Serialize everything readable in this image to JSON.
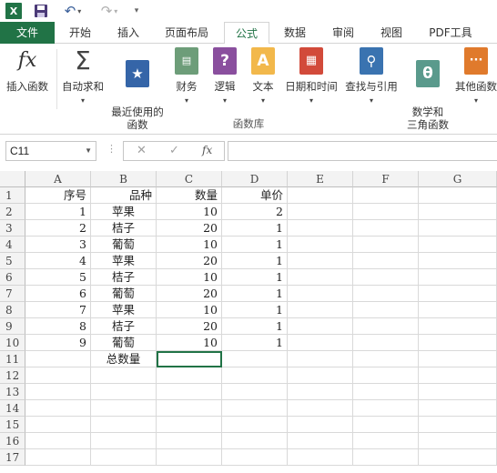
{
  "qat": {
    "logo_text": "X",
    "undo_glyph": "↶",
    "redo_glyph": "↷"
  },
  "tabs": [
    "文件",
    "开始",
    "插入",
    "页面布局",
    "公式",
    "数据",
    "审阅",
    "视图",
    "PDF工具"
  ],
  "active_tab": "公式",
  "ribbon": {
    "buttons": [
      {
        "label": "插入函数",
        "icon": "fx-icon"
      },
      {
        "label": "自动求和",
        "icon": "sigma-icon"
      },
      {
        "label": "最近使用的\n函数",
        "icon": "star-icon"
      },
      {
        "label": "财务",
        "icon": "coins-icon"
      },
      {
        "label": "逻辑",
        "icon": "question-icon"
      },
      {
        "label": "文本",
        "icon": "text-a-icon"
      },
      {
        "label": "日期和时间",
        "icon": "calendar-icon"
      },
      {
        "label": "查找与引用",
        "icon": "magnifier-icon"
      },
      {
        "label": "数学和\n三角函数",
        "icon": "theta-icon"
      },
      {
        "label": "其他函数",
        "icon": "more-icon"
      }
    ],
    "group_label": "函数库"
  },
  "formula_bar": {
    "name_box": "C11",
    "cancel_glyph": "✕",
    "enter_glyph": "✓",
    "fx_glyph": "fx",
    "value": ""
  },
  "grid": {
    "columns": [
      "A",
      "B",
      "C",
      "D",
      "E",
      "F",
      "G"
    ],
    "rows": [
      "1",
      "2",
      "3",
      "4",
      "5",
      "6",
      "7",
      "8",
      "9",
      "10",
      "11",
      "12",
      "13",
      "14",
      "15",
      "16",
      "17"
    ],
    "data": [
      [
        "序号",
        "品种",
        "数量",
        "单价"
      ],
      [
        "1",
        "苹果",
        "10",
        "2"
      ],
      [
        "2",
        "桔子",
        "20",
        "1"
      ],
      [
        "3",
        "葡萄",
        "10",
        "1"
      ],
      [
        "4",
        "苹果",
        "20",
        "1"
      ],
      [
        "5",
        "桔子",
        "10",
        "1"
      ],
      [
        "6",
        "葡萄",
        "20",
        "1"
      ],
      [
        "7",
        "苹果",
        "10",
        "1"
      ],
      [
        "8",
        "桔子",
        "20",
        "1"
      ],
      [
        "9",
        "葡萄",
        "10",
        "1"
      ],
      [
        "",
        "总数量",
        "",
        ""
      ]
    ]
  },
  "colors": {
    "excel_green": "#217346",
    "fx_orange": "#e2861e"
  }
}
